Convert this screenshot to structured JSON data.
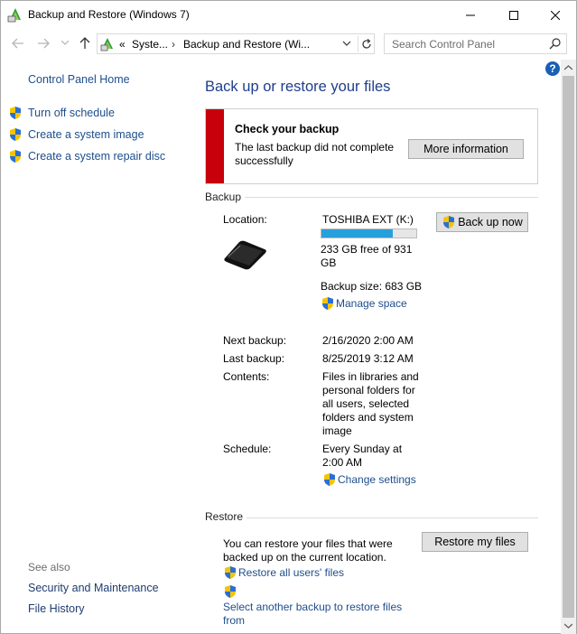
{
  "window": {
    "title": "Backup and Restore (Windows 7)"
  },
  "nav": {
    "address_prefix": "«",
    "address_crumbs": [
      "Syste...",
      "Backup and Restore (Wi..."
    ],
    "search_placeholder": "Search Control Panel"
  },
  "sidebar": {
    "home": "Control Panel Home",
    "items": [
      {
        "label": "Turn off schedule"
      },
      {
        "label": "Create a system image"
      },
      {
        "label": "Create a system repair disc"
      }
    ],
    "see_also_header": "See also",
    "see_also": [
      {
        "label": "Security and Maintenance"
      },
      {
        "label": "File History"
      }
    ]
  },
  "main": {
    "title": "Back up or restore your files",
    "alert": {
      "title": "Check your backup",
      "body": "The last backup did not complete successfully",
      "button": "More information",
      "color": "#c7000b"
    },
    "backup": {
      "section": "Backup",
      "location_label": "Location:",
      "location_value": "TOSHIBA EXT (K:)",
      "backup_now": "Back up now",
      "free_space": "233 GB free of 931 GB",
      "used_fraction": 0.75,
      "backup_size": "Backup size: 683 GB",
      "manage_space": "Manage space",
      "next_label": "Next backup:",
      "next_value": "2/16/2020 2:00 AM",
      "last_label": "Last backup:",
      "last_value": "8/25/2019 3:12 AM",
      "contents_label": "Contents:",
      "contents_value": "Files in libraries and personal folders for all users, selected folders and system image",
      "schedule_label": "Schedule:",
      "schedule_value": "Every Sunday at 2:00 AM",
      "change_settings": "Change settings"
    },
    "restore": {
      "section": "Restore",
      "text": "You can restore your files that were backed up on the current location.",
      "button": "Restore my files",
      "restore_all": "Restore all users' files",
      "select_another": "Select another backup to restore files from"
    }
  },
  "colors": {
    "link": "#1e4e8c",
    "title": "#1e3d8c",
    "progress": "#26a0da"
  }
}
